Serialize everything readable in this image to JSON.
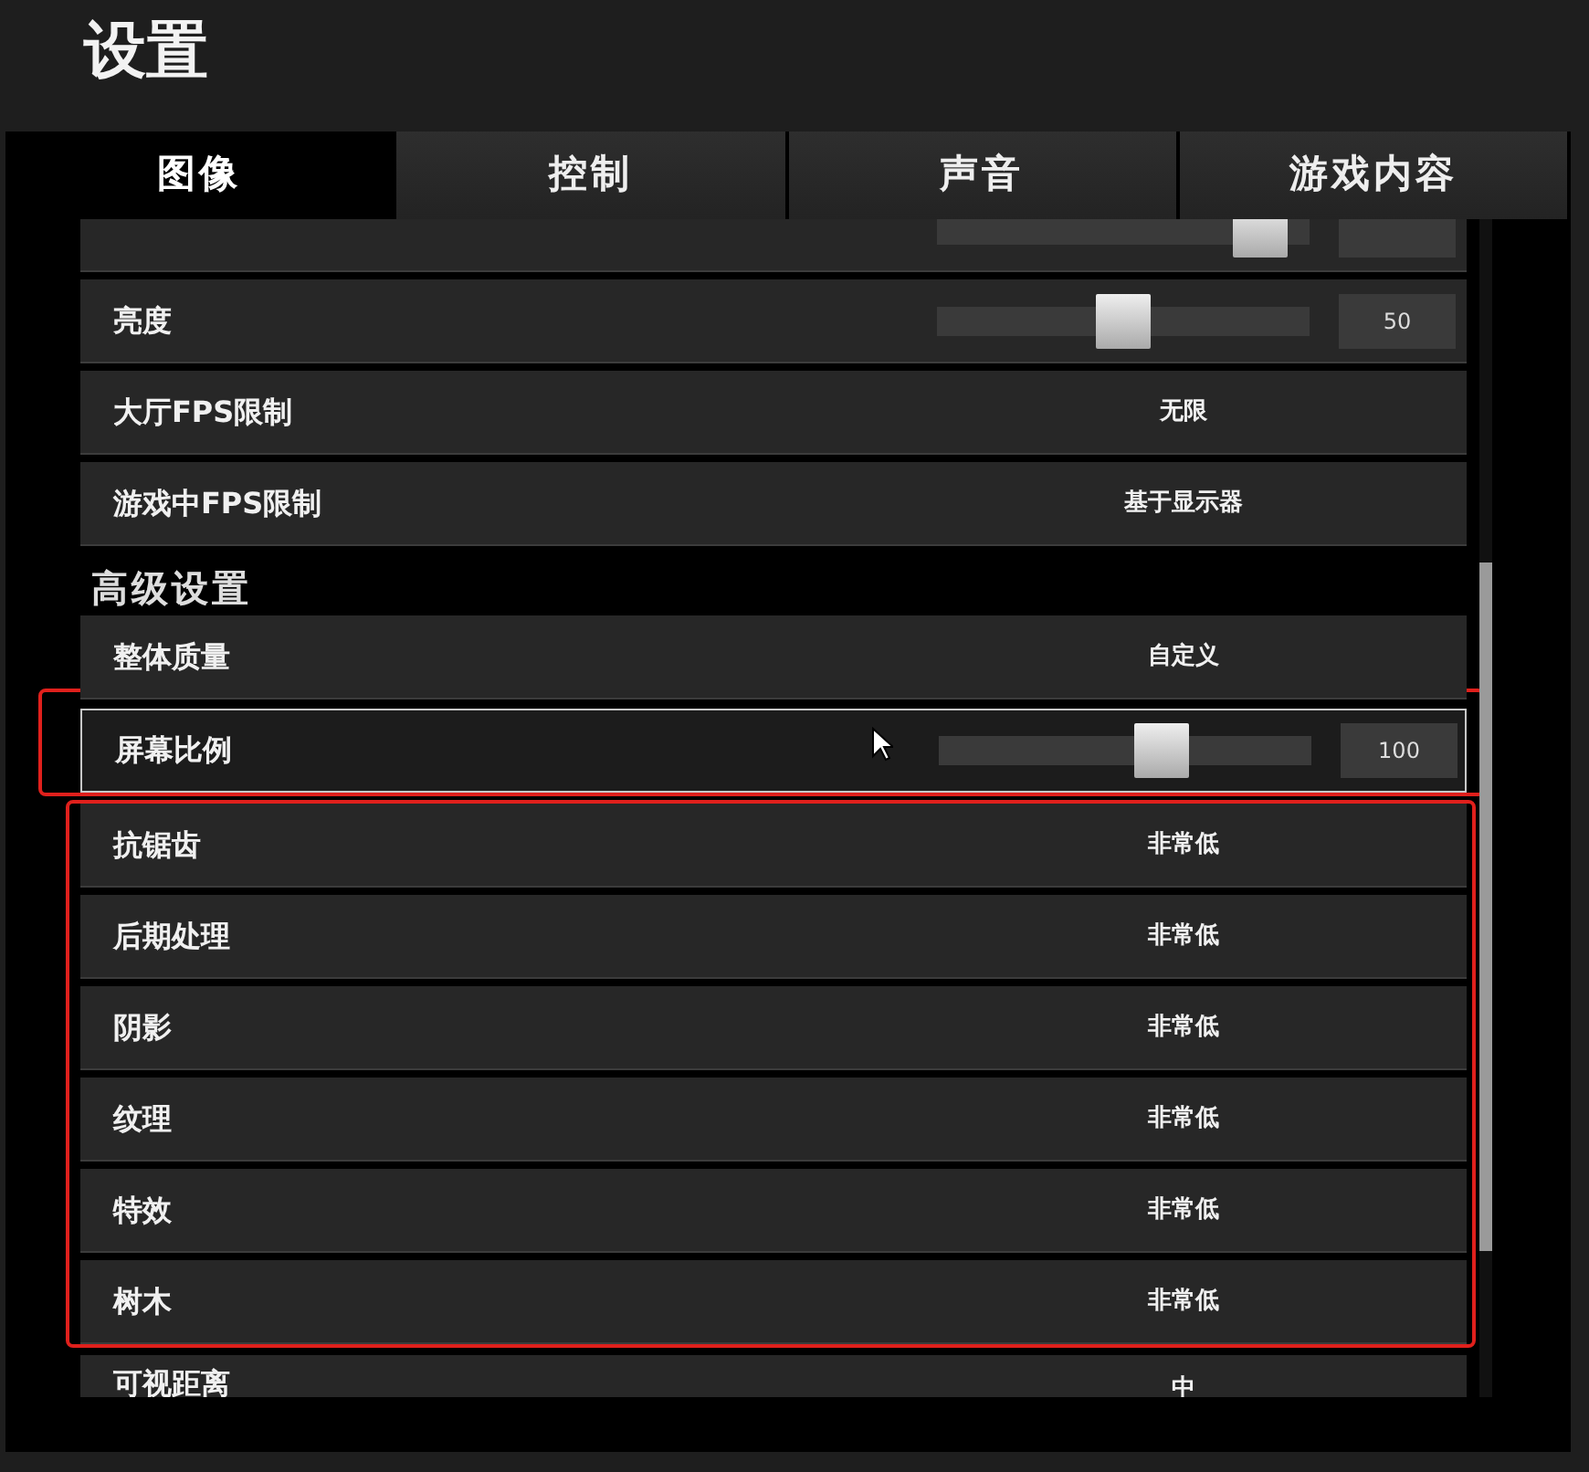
{
  "title": "设置",
  "tabs": [
    {
      "label": "图像",
      "selected": true
    },
    {
      "label": "控制",
      "selected": false
    },
    {
      "label": "声音",
      "selected": false
    },
    {
      "label": "游戏内容",
      "selected": false
    }
  ],
  "groups": [
    {
      "highlighted": false,
      "rows": [
        {
          "kind": "slider",
          "level": 0.87
        },
        {
          "kind": "slider",
          "label": "亮度",
          "level": 0.5,
          "value": "50"
        },
        {
          "kind": "option",
          "label": "大厅FPS限制",
          "value": "无限"
        },
        {
          "kind": "option",
          "label": "游戏中FPS限制",
          "value": "基于显示器"
        },
        {
          "kind": "heading",
          "label": "高级设置"
        },
        {
          "kind": "option",
          "label": "整体质量",
          "value": "自定义"
        }
      ]
    },
    {
      "highlighted": true,
      "rows": [
        {
          "kind": "slider",
          "label": "屏幕比例",
          "level": 0.6,
          "value": "100",
          "hovered": true
        }
      ]
    },
    {
      "highlighted": true,
      "rows": [
        {
          "kind": "option",
          "label": "抗锯齿",
          "value": "非常低"
        },
        {
          "kind": "option",
          "label": "后期处理",
          "value": "非常低"
        },
        {
          "kind": "option",
          "label": "阴影",
          "value": "非常低"
        },
        {
          "kind": "option",
          "label": "纹理",
          "value": "非常低"
        },
        {
          "kind": "option",
          "label": "特效",
          "value": "非常低"
        },
        {
          "kind": "option",
          "label": "树木",
          "value": "非常低"
        }
      ]
    },
    {
      "highlighted": false,
      "rows": [
        {
          "kind": "option",
          "label": "可视距离",
          "value": "中"
        }
      ]
    }
  ]
}
